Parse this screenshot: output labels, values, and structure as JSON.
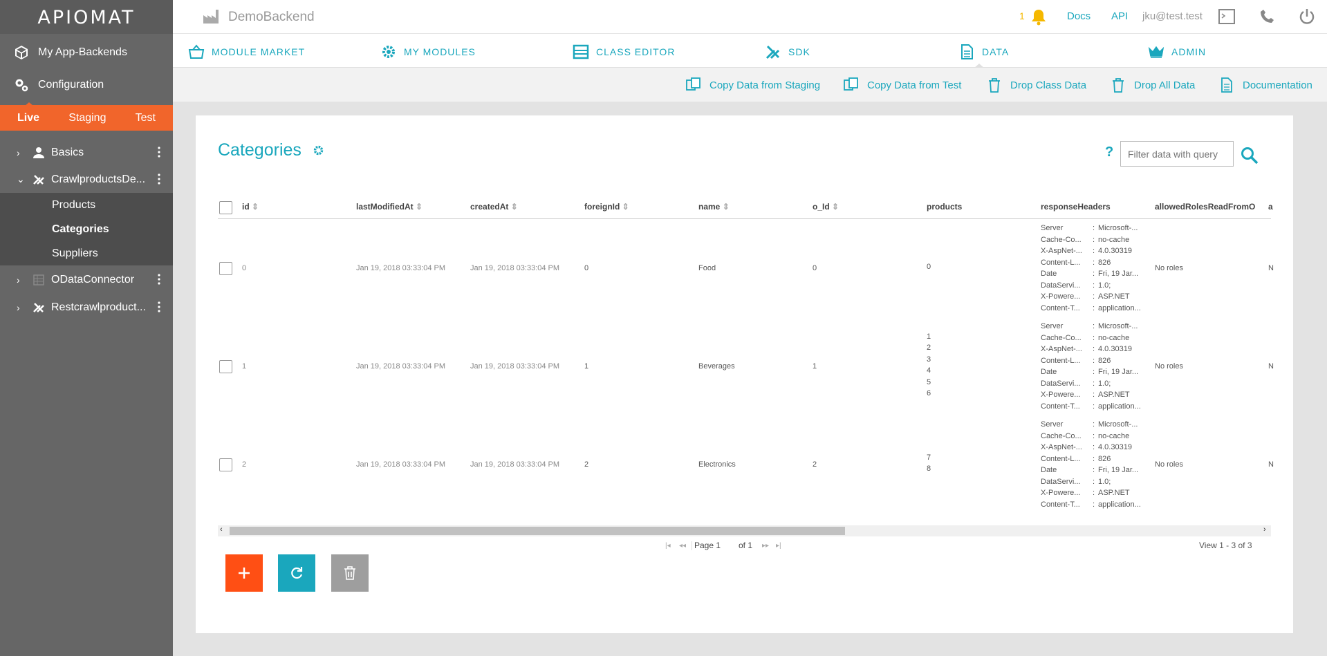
{
  "app": {
    "logo_text": "APIOMAT",
    "backend": "DemoBackend"
  },
  "header": {
    "notification_count": "1",
    "docs": "Docs",
    "api": "API",
    "user": "jku@test.test"
  },
  "sidebar": {
    "my_backends": "My App-Backends",
    "configuration": "Configuration",
    "stages": [
      "Live",
      "Staging",
      "Test"
    ],
    "tree": [
      {
        "label": "Basics"
      },
      {
        "label": "CrawlproductsDe...",
        "children": [
          "Products",
          "Categories",
          "Suppliers"
        ]
      },
      {
        "label": "ODataConnector"
      },
      {
        "label": "Restcrawlproduct..."
      }
    ]
  },
  "modules": [
    "MODULE MARKET",
    "MY MODULES",
    "CLASS EDITOR",
    "SDK",
    "DATA",
    "ADMIN"
  ],
  "actions": [
    "Copy Data from Staging",
    "Copy Data from Test",
    "Drop Class Data",
    "Drop All Data",
    "Documentation"
  ],
  "main": {
    "title": "Categories",
    "help": "?",
    "filter_placeholder": "Filter data with query"
  },
  "table": {
    "headers": [
      "id",
      "lastModifiedAt",
      "createdAt",
      "foreignId",
      "name",
      "o_Id",
      "products",
      "responseHeaders",
      "allowedRolesReadFromO"
    ],
    "header_extra": "a",
    "rows": [
      {
        "id": "0",
        "lastModifiedAt": "Jan 19, 2018 03:33:04 PM",
        "createdAt": "Jan 19, 2018 03:33:04 PM",
        "foreignId": "0",
        "name": "Food",
        "o_Id": "0",
        "products": [
          "0"
        ],
        "roles": "No roles",
        "trail": "N"
      },
      {
        "id": "1",
        "lastModifiedAt": "Jan 19, 2018 03:33:04 PM",
        "createdAt": "Jan 19, 2018 03:33:04 PM",
        "foreignId": "1",
        "name": "Beverages",
        "o_Id": "1",
        "products": [
          "1",
          "2",
          "3",
          "4",
          "5",
          "6"
        ],
        "roles": "No roles",
        "trail": "N"
      },
      {
        "id": "2",
        "lastModifiedAt": "Jan 19, 2018 03:33:04 PM",
        "createdAt": "Jan 19, 2018 03:33:04 PM",
        "foreignId": "2",
        "name": "Electronics",
        "o_Id": "2",
        "products": [
          "7",
          "8"
        ],
        "roles": "No roles",
        "trail": "N"
      }
    ],
    "response_headers": [
      [
        "Server",
        ":",
        "Microsoft-..."
      ],
      [
        "Cache-Co...",
        ":",
        "no-cache"
      ],
      [
        "X-AspNet-...",
        ":",
        "4.0.30319"
      ],
      [
        "Content-L...",
        ":",
        "826"
      ],
      [
        "Date",
        ":",
        "Fri, 19 Jar..."
      ],
      [
        "DataServi...",
        ":",
        "1.0;"
      ],
      [
        "X-Powere...",
        ":",
        "ASP.NET"
      ],
      [
        "Content-T...",
        ":",
        "application..."
      ]
    ]
  },
  "pager": {
    "page_label": "Page 1",
    "of": "of 1",
    "view": "View 1 - 3 of 3"
  },
  "colors": {
    "accent": "#1aa7bd",
    "stage": "#f1652b",
    "add": "#ff4f14",
    "refresh": "#1aa7bd",
    "delete": "#9e9e9e"
  }
}
